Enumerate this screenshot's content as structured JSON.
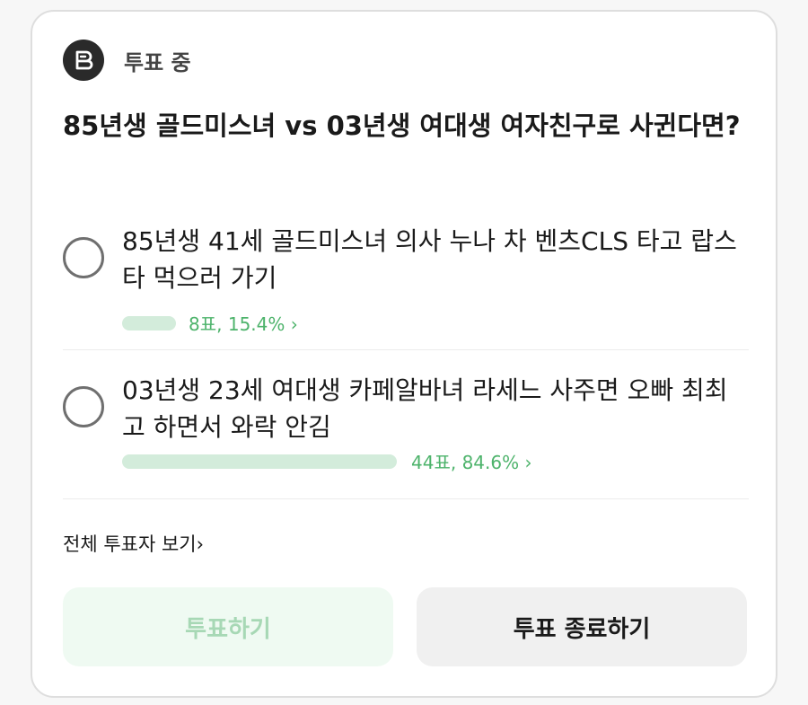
{
  "poll": {
    "status_label": "투표 중",
    "question": "85년생 골드미스녀 vs 03년생 여대생 여자친구로 사귄다면?",
    "options": [
      {
        "text": "85년생 41세 골드미스녀 의사 누나 차 벤츠CLS 타고 랍스타 먹으러 가기",
        "votes_label": "8표, 15.4% ›",
        "percent": 15.4
      },
      {
        "text": "03년생 23세 여대생 카페알바녀 라세느 사주면 오빠 최최고 하면서 와락 안김",
        "votes_label": "44표, 84.6% ›",
        "percent": 84.6
      }
    ],
    "view_all_voters": "전체 투표자 보기›",
    "vote_button": "투표하기",
    "end_vote_button": "투표 종료하기"
  },
  "colors": {
    "accent_green": "#4db36b",
    "bar_green": "#d3ecdb",
    "vote_button_bg": "#effaf2"
  },
  "icons": {
    "status": "poll-badge-icon"
  }
}
